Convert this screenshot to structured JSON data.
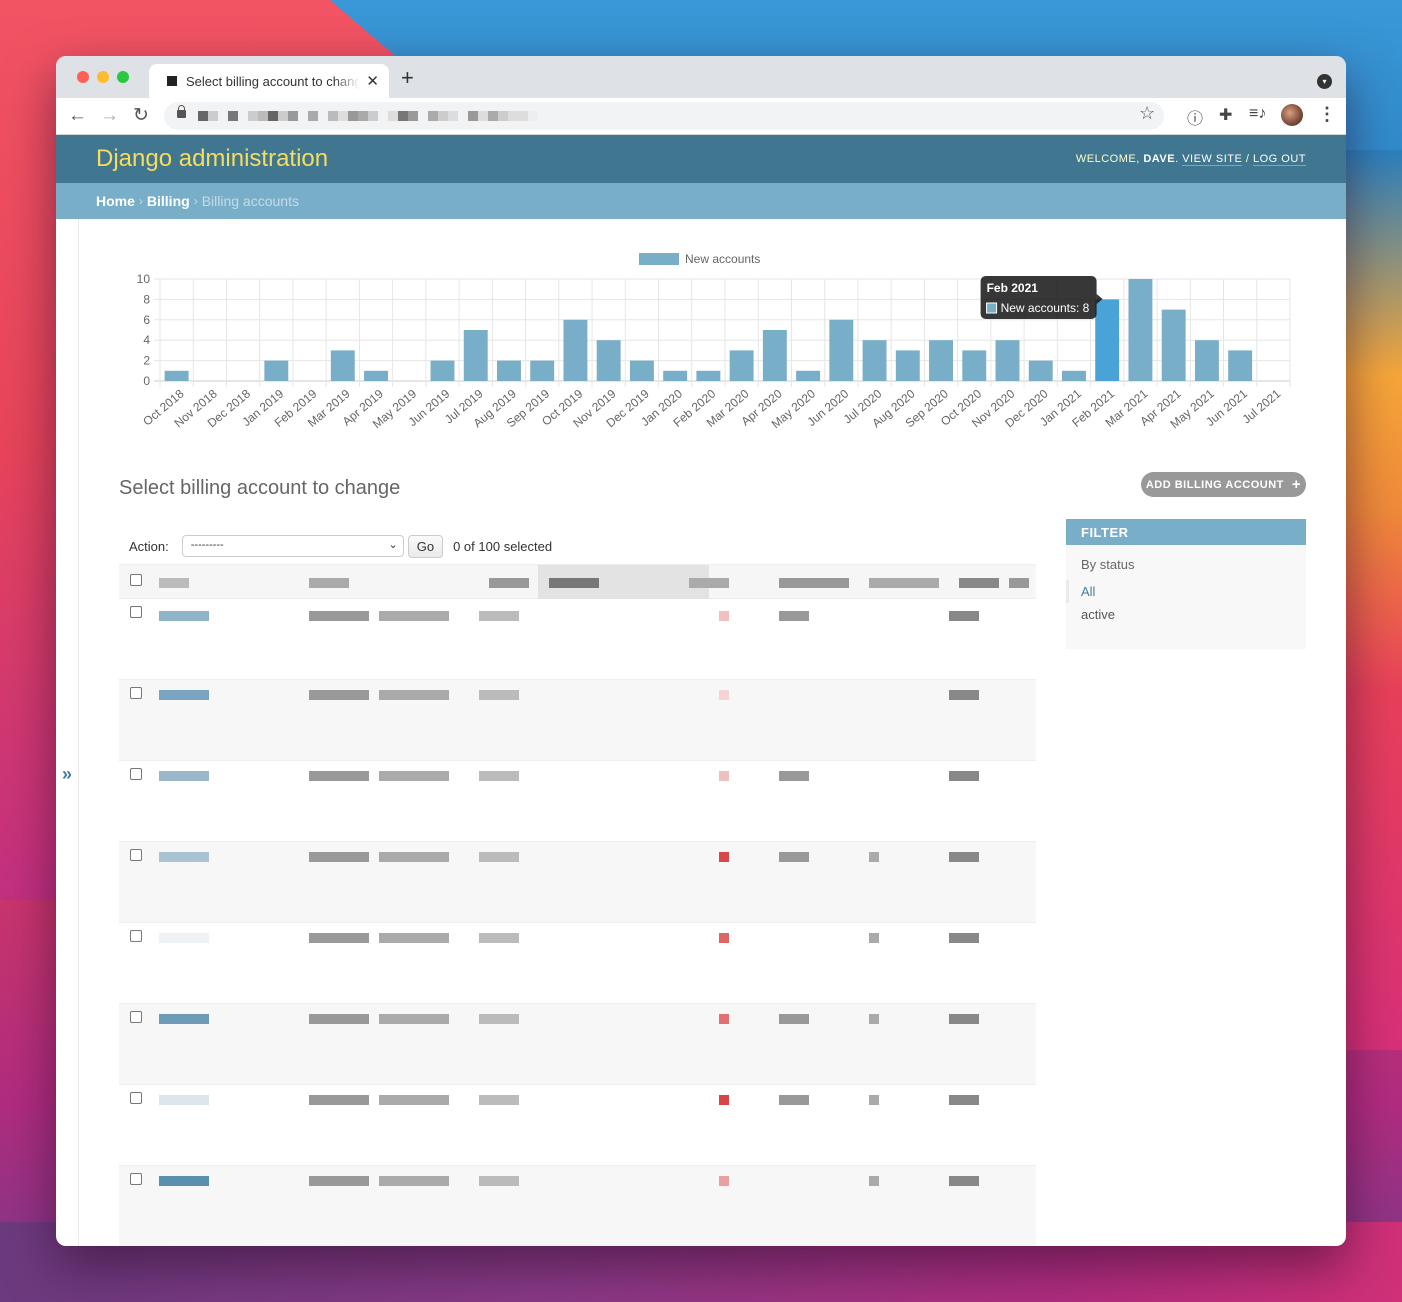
{
  "browser": {
    "tab_title": "Select billing account to change",
    "tab_close": "✕",
    "new_tab": "+",
    "back": "←",
    "forward": "→",
    "reload": "↻",
    "star": "☆",
    "password_icon": "ⓘ",
    "extensions_icon": "✚",
    "media_icon": "≡♪",
    "menu": "⋮",
    "tab_search": "▾"
  },
  "header": {
    "brand": "Django administration",
    "welcome": "Welcome, ",
    "user": "Dave",
    "view_site": "View site",
    "separator": " / ",
    "log_out": "Log out"
  },
  "breadcrumbs": {
    "home": "Home",
    "app": "Billing",
    "current": "Billing accounts",
    "sep": "›"
  },
  "nav_toggle": "»",
  "chart_data": {
    "type": "bar",
    "legend": [
      "New accounts"
    ],
    "legend_position": "top",
    "categories": [
      "Oct 2018",
      "Nov 2018",
      "Dec 2018",
      "Jan 2019",
      "Feb 2019",
      "Mar 2019",
      "Apr 2019",
      "May 2019",
      "Jun 2019",
      "Jul 2019",
      "Aug 2019",
      "Sep 2019",
      "Oct 2019",
      "Nov 2019",
      "Dec 2019",
      "Jan 2020",
      "Feb 2020",
      "Mar 2020",
      "Apr 2020",
      "May 2020",
      "Jun 2020",
      "Jul 2020",
      "Aug 2020",
      "Sep 2020",
      "Oct 2020",
      "Nov 2020",
      "Dec 2020",
      "Jan 2021",
      "Feb 2021",
      "Mar 2021",
      "Apr 2021",
      "May 2021",
      "Jun 2021",
      "Jul 2021"
    ],
    "series": [
      {
        "name": "New accounts",
        "values": [
          1,
          0,
          0,
          2,
          0,
          3,
          1,
          0,
          2,
          5,
          2,
          2,
          6,
          4,
          2,
          1,
          1,
          3,
          5,
          1,
          6,
          4,
          3,
          4,
          3,
          4,
          2,
          1,
          8,
          10,
          7,
          4,
          3,
          0
        ]
      }
    ],
    "yticks": [
      0,
      2,
      4,
      6,
      8,
      10
    ],
    "ylim": [
      0,
      10
    ],
    "grid": true,
    "colors": {
      "bar": "#79aec8",
      "bar_hover": "#4aa3d6"
    },
    "tooltip": {
      "category": "Feb 2021",
      "label": "New accounts: 8"
    }
  },
  "content": {
    "title": "Select billing account to change",
    "add_button": "Add billing account",
    "add_icon": "+"
  },
  "actions": {
    "label": "Action:",
    "selected_option": "---------",
    "go": "Go",
    "counter": "0 of 100 selected"
  },
  "filter": {
    "title": "Filter",
    "by": "By status",
    "options": [
      {
        "label": "All",
        "selected": true
      },
      {
        "label": "active",
        "selected": false
      }
    ]
  },
  "table": {
    "row_count_visible": 8,
    "cells_redacted": true
  }
}
